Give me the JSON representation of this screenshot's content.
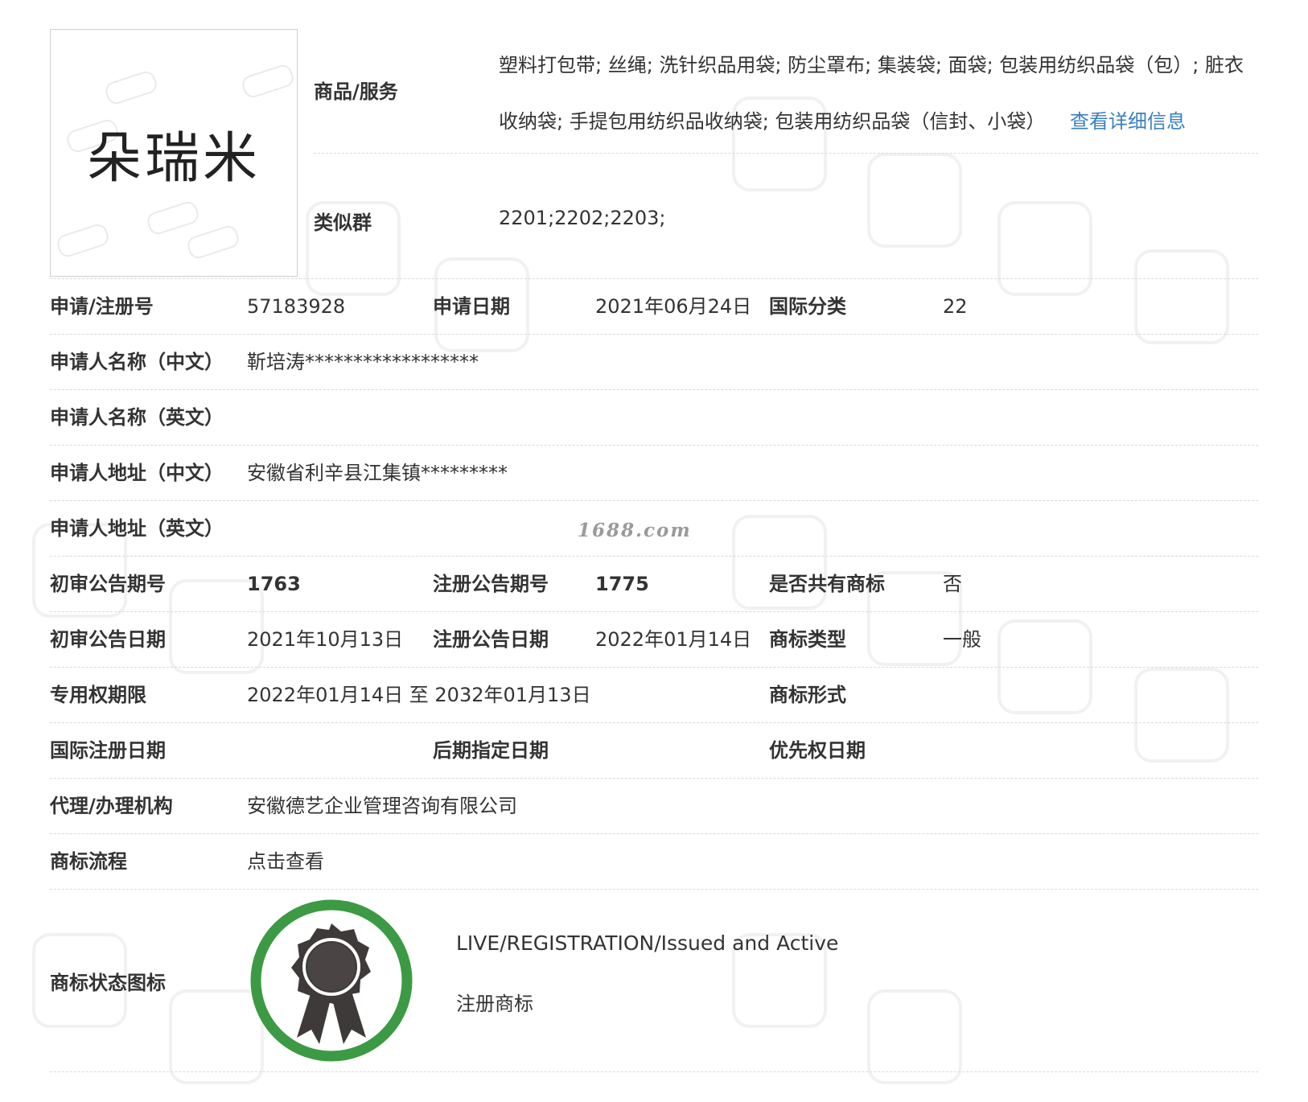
{
  "logo": {
    "text": "朵瑞米"
  },
  "goods_services": {
    "label": "商品/服务",
    "text": "塑料打包带; 丝绳; 洗针织品用袋; 防尘罩布; 集装袋; 面袋; 包装用纺织品袋（包）; 脏衣收纳袋; 手提包用纺织品收纳袋; 包装用纺织品袋（信封、小袋）",
    "detail_link": "查看详细信息"
  },
  "similar_group": {
    "label": "类似群",
    "value": "2201;2202;2203;"
  },
  "rows": {
    "reg_no": {
      "label": "申请/注册号",
      "value": "57183928"
    },
    "apply_date": {
      "label": "申请日期",
      "value": "2021年06月24日"
    },
    "intl_class": {
      "label": "国际分类",
      "value": "22"
    },
    "applicant_cn": {
      "label": "申请人名称（中文）",
      "value": "靳培涛******************"
    },
    "applicant_en": {
      "label": "申请人名称（英文）",
      "value": ""
    },
    "address_cn": {
      "label": "申请人地址（中文）",
      "value": "安徽省利辛县江集镇*********"
    },
    "address_en": {
      "label": "申请人地址（英文）",
      "value": ""
    },
    "prelim_issue": {
      "label": "初审公告期号",
      "value": "1763"
    },
    "reg_issue": {
      "label": "注册公告期号",
      "value": "1775"
    },
    "shared": {
      "label": "是否共有商标",
      "value": "否"
    },
    "prelim_date": {
      "label": "初审公告日期",
      "value": "2021年10月13日"
    },
    "reg_date": {
      "label": "注册公告日期",
      "value": "2022年01月14日"
    },
    "tm_type": {
      "label": "商标类型",
      "value": "一般"
    },
    "exclusive_period": {
      "label": "专用权期限",
      "value": "2022年01月14日 至 2032年01月13日"
    },
    "tm_form": {
      "label": "商标形式",
      "value": ""
    },
    "intl_reg_date": {
      "label": "国际注册日期",
      "value": ""
    },
    "later_designation": {
      "label": "后期指定日期",
      "value": ""
    },
    "priority_date": {
      "label": "优先权日期",
      "value": ""
    },
    "agency": {
      "label": "代理/办理机构",
      "value": "安徽德艺企业管理咨询有限公司"
    },
    "process": {
      "label": "商标流程",
      "value": "点击查看"
    }
  },
  "status": {
    "label": "商标状态图标",
    "en": "LIVE/REGISTRATION/Issued and Active",
    "cn": "注册商标",
    "icon": "award-ribbon-icon",
    "ring_color": "#3c9a44",
    "medal_color": "#3f3a3a"
  },
  "watermark": {
    "site": "1688.com"
  }
}
